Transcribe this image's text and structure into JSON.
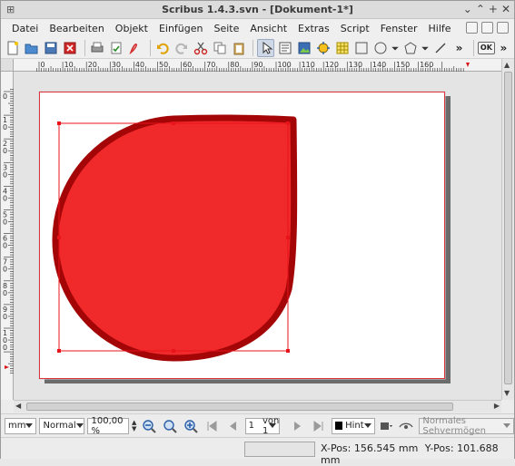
{
  "window": {
    "title": "Scribus 1.4.3.svn - [Dokument-1*]",
    "title_left_glyph": "⊞",
    "controls": [
      "⌄",
      "⌃",
      "+",
      "✕"
    ]
  },
  "menubar": {
    "items": [
      "Datei",
      "Bearbeiten",
      "Objekt",
      "Einfügen",
      "Seite",
      "Ansicht",
      "Extras",
      "Script",
      "Fenster",
      "Hilfe"
    ]
  },
  "toolbar": {
    "icons": [
      "new-document-icon",
      "open-folder-icon",
      "save-icon",
      "close-document-icon",
      "print-icon",
      "preflight-icon",
      "pdf-export-icon",
      "undo-icon",
      "redo-icon",
      "cut-icon",
      "copy-icon",
      "paste-icon",
      "select-arrow-icon",
      "text-frame-icon",
      "image-frame-icon",
      "render-frame-icon",
      "table-icon",
      "shape-icon",
      "polygon-icon",
      "line-icon"
    ],
    "overflow_label": "»",
    "ok_label": "OK"
  },
  "ruler": {
    "h_labels": [
      "0",
      "10",
      "20",
      "30",
      "40",
      "50",
      "60",
      "70",
      "80",
      "90",
      "100",
      "110",
      "120",
      "130",
      "140",
      "150",
      "160"
    ],
    "v_labels": [
      "0",
      "10",
      "20",
      "30",
      "40",
      "50",
      "60",
      "70",
      "80",
      "90",
      "100"
    ]
  },
  "bottombar": {
    "unit": "mm",
    "mode": "Normal",
    "zoom": "100,00 %",
    "page_number": "1",
    "page_of": "von 1",
    "layer": "Hint",
    "view_mode": "Normales Sehvermögen"
  },
  "status": {
    "xpos_label": "X-Pos:",
    "xpos_value": "156.545 mm",
    "ypos_label": "Y-Pos:",
    "ypos_value": "101.688 mm"
  },
  "colors": {
    "shape_fill": "#f0292a",
    "shape_stroke": "#a40506",
    "selection": "#e8141a",
    "page_shadow": "#6b6b6b",
    "page_margin": "#e0323a"
  }
}
